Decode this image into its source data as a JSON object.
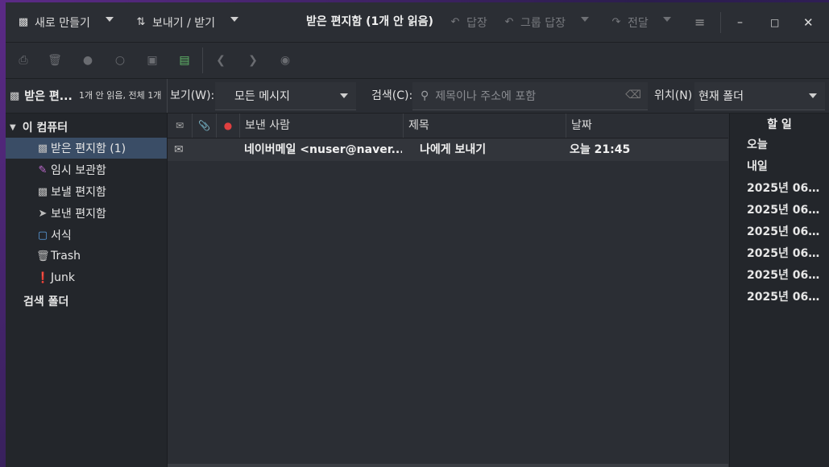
{
  "titlebar": {
    "new_label": "새로 만들기",
    "sendrecv_label": "보내기 / 받기",
    "title": "받은 편지함 (1개 안 읽음)",
    "reply_label": "답장",
    "reply_all_label": "그룹 답장",
    "forward_label": "전달"
  },
  "filterbar": {
    "folder_name": "받은 편...",
    "folder_counts": "1개 안 읽음, 전체 1개",
    "view_label": "보기(W):",
    "view_value": "모든 메시지",
    "search_label": "검색(C):",
    "search_placeholder": "제목이나 주소에 포함",
    "location_label": "위치(N)",
    "location_value": "현재 폴더"
  },
  "sidebar": {
    "root_label": "이 컴퓨터",
    "items": [
      {
        "label": "받은 편지함 (1)",
        "icon": "inbox-icon"
      },
      {
        "label": "임시 보관함",
        "icon": "drafts-icon"
      },
      {
        "label": "보낼 편지함",
        "icon": "outbox-icon"
      },
      {
        "label": "보낸 편지함",
        "icon": "sent-icon"
      },
      {
        "label": "서식",
        "icon": "templates-folder-icon"
      },
      {
        "label": "Trash",
        "icon": "trash-icon"
      },
      {
        "label": "Junk",
        "icon": "junk-icon"
      }
    ],
    "search_folders_label": "검색 폴더"
  },
  "message_list": {
    "columns": {
      "from": "보낸 사람",
      "subject": "제목",
      "date": "날짜"
    },
    "rows": [
      {
        "from": "네이버메일 <nuser@naver....",
        "subject": "나에게 보내기",
        "date": "오늘 21:45"
      }
    ]
  },
  "todo": {
    "title": "할 일",
    "items": [
      "오늘",
      "내일",
      "2025년 06월 ...",
      "2025년 06월 ...",
      "2025년 06월 ...",
      "2025년 06월 ...",
      "2025년 06월 ...",
      "2025년 06월 ..."
    ]
  },
  "colors": {
    "selection": "#3a4d66",
    "accent_green": "#62b86a",
    "important_red": "#e04040"
  }
}
